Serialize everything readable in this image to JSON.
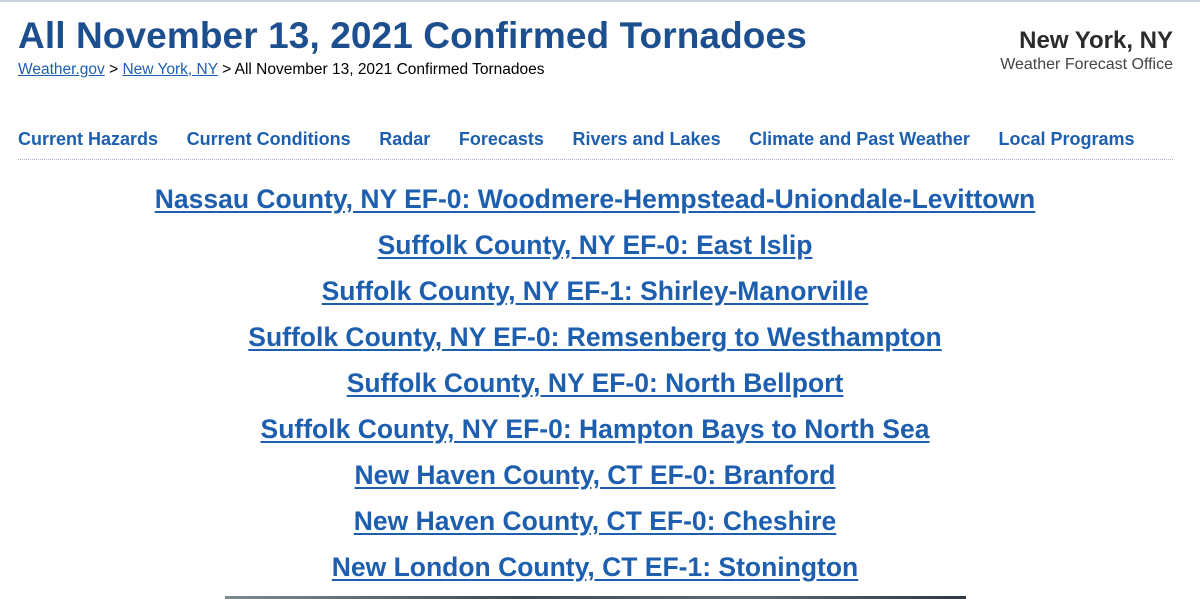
{
  "header": {
    "title": "All November 13, 2021 Confirmed Tornadoes",
    "breadcrumb": {
      "home": "Weather.gov",
      "sep1": ">",
      "office": "New York, NY",
      "sep2": ">",
      "current": "All November 13, 2021 Confirmed Tornadoes"
    },
    "office_name": "New York, NY",
    "office_type": "Weather Forecast Office"
  },
  "nav": {
    "items": [
      "Current Hazards",
      "Current Conditions",
      "Radar",
      "Forecasts",
      "Rivers and Lakes",
      "Climate and Past Weather",
      "Local Programs"
    ]
  },
  "tornadoes": [
    "Nassau County, NY EF-0: Woodmere-Hempstead-Uniondale-Levittown",
    "Suffolk County, NY EF-0: East Islip",
    "Suffolk County, NY EF-1: Shirley-Manorville",
    "Suffolk County, NY EF-0: Remsenberg to Westhampton",
    "Suffolk County, NY EF-0: North Bellport",
    "Suffolk County, NY EF-0: Hampton Bays to North Sea",
    "New Haven County, CT EF-0: Branford",
    "New Haven County, CT EF-0: Cheshire",
    "New London County, CT EF-1: Stonington"
  ],
  "colors": {
    "title": "#1d4f8e",
    "link": "#1d5fae"
  }
}
